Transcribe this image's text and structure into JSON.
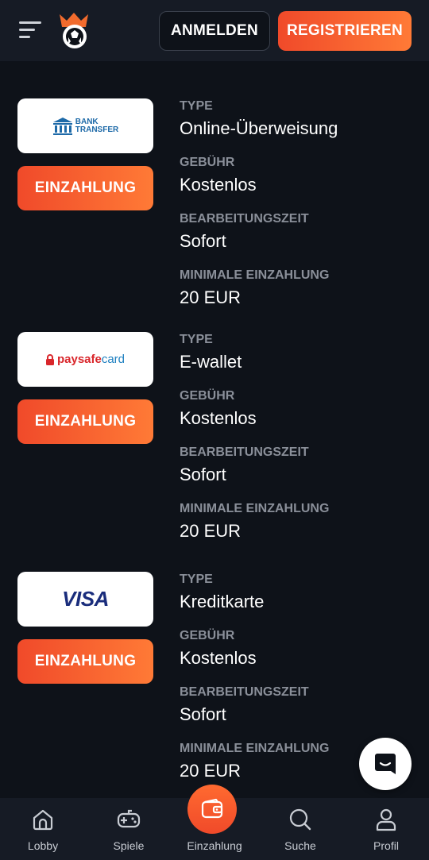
{
  "header": {
    "login_label": "ANMELDEN",
    "register_label": "REGISTRIEREN"
  },
  "labels": {
    "type": "TYPE",
    "fee": "GEBÜHR",
    "processing": "BEARBEITUNGSZEIT",
    "min_deposit": "MINIMALE EINZAHLUNG"
  },
  "methods": [
    {
      "logo_name": "bank-transfer",
      "logo_text_1": "BANK",
      "logo_text_2": "TRANSFER",
      "deposit_label": "EINZAHLUNG",
      "type": "Online-Überweisung",
      "fee": "Kostenlos",
      "processing": "Sofort",
      "min_deposit": "20 EUR"
    },
    {
      "logo_name": "paysafecard",
      "logo_text_1": "paysafe",
      "logo_text_2": "card",
      "deposit_label": "EINZAHLUNG",
      "type": "E-wallet",
      "fee": "Kostenlos",
      "processing": "Sofort",
      "min_deposit": "20 EUR"
    },
    {
      "logo_name": "visa",
      "logo_text_1": "VISA",
      "deposit_label": "EINZAHLUNG",
      "type": "Kreditkarte",
      "fee": "Kostenlos",
      "processing": "Sofort",
      "min_deposit": "20 EUR"
    }
  ],
  "nav": {
    "lobby": "Lobby",
    "games": "Spiele",
    "deposit": "Einzahlung",
    "search": "Suche",
    "profile": "Profil"
  },
  "colors": {
    "background": "#0e1219",
    "header": "#161b25",
    "accent_orange": "#f04a2a",
    "accent_orange_light": "#ff7a36",
    "label_gray": "#8a8f99"
  }
}
